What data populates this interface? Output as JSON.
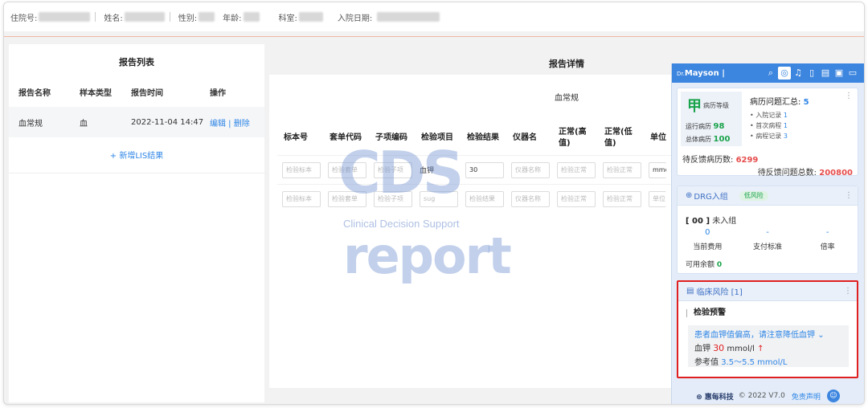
{
  "patient": {
    "fields": [
      {
        "label": "住院号:"
      },
      {
        "label": "姓名:"
      },
      {
        "label": "性别:"
      },
      {
        "label": "年龄:"
      },
      {
        "label": "科室:"
      },
      {
        "label": "入院日期:"
      }
    ]
  },
  "report_list": {
    "title": "报告列表",
    "columns": [
      "报告名称",
      "样本类型",
      "报告时间",
      "操作"
    ],
    "rows": [
      {
        "name": "血常规",
        "sample": "血",
        "time": "2022-11-04 14:47",
        "actions": "编辑 | 删除"
      }
    ],
    "add_label": "+ 新增LIS结果"
  },
  "report_detail": {
    "title": "报告详情",
    "subtitle": "血常规",
    "columns": [
      "标本号",
      "套单代码",
      "子项编码",
      "检验项目",
      "检验结果",
      "仪器名",
      "正常(高值)",
      "正常(低值)",
      "单位"
    ],
    "rows": [
      [
        "检验标本",
        "检验套单",
        "检验子项",
        "血钾",
        "30",
        "仪器名称",
        "检验正常",
        "检验正常",
        "mmol"
      ],
      [
        "检验标本",
        "检验套单",
        "检验子项",
        "sug",
        "检验结果",
        "仪器名称",
        "检验正常",
        "检验正常",
        "单位"
      ]
    ]
  },
  "watermark": {
    "big": "CDS",
    "sub": "Clinical Decision Support",
    "report": "report"
  },
  "cds": {
    "brand": "Mayson |",
    "brand_prefix": "Dr.",
    "record_card": {
      "grade": "甲",
      "grade_label": "病历等级",
      "running_label": "运行病历",
      "running_value": "98",
      "total_label": "总体病历",
      "total_value": "100",
      "problem_title": "病历问题汇总:",
      "problem_count": "5",
      "problems": [
        {
          "label": "• 入院记录",
          "count": "1"
        },
        {
          "label": "• 首次病程",
          "count": "1"
        },
        {
          "label": "• 病程记录",
          "count": "3"
        }
      ],
      "pending_label": "待反馈病历数:",
      "pending_value": "6299",
      "pending_total_label": "待反馈问题总数:",
      "pending_total_value": "200800"
    },
    "drg_card": {
      "title": "DRG入组",
      "risk_pill": "低风险",
      "group_code": "[ 00 ]",
      "group_label": "未入组",
      "cols": [
        {
          "value": "0",
          "label": "当前费用"
        },
        {
          "value": "-",
          "label": "支付标准"
        },
        {
          "value": "-",
          "label": "倍率"
        }
      ],
      "balance_label": "可用余额",
      "balance_value": "0"
    },
    "risk_card": {
      "title": "临床风险 [1]",
      "subtitle": "检验预警",
      "message": "患者血钾值偏高，请注意降低血钾",
      "item": "血钾",
      "value": "30",
      "unit": "mmol/l",
      "ref_label": "参考值",
      "ref_value": "3.5～5.5 mmol/L"
    },
    "footer": {
      "logo": "惠每科技",
      "copyright": "© 2022 V7.0",
      "disclaimer": "免责声明"
    }
  },
  "colors": {
    "accent": "#3d86df",
    "link": "#2f86e6",
    "danger": "#e02020",
    "success": "#1aa34a"
  }
}
